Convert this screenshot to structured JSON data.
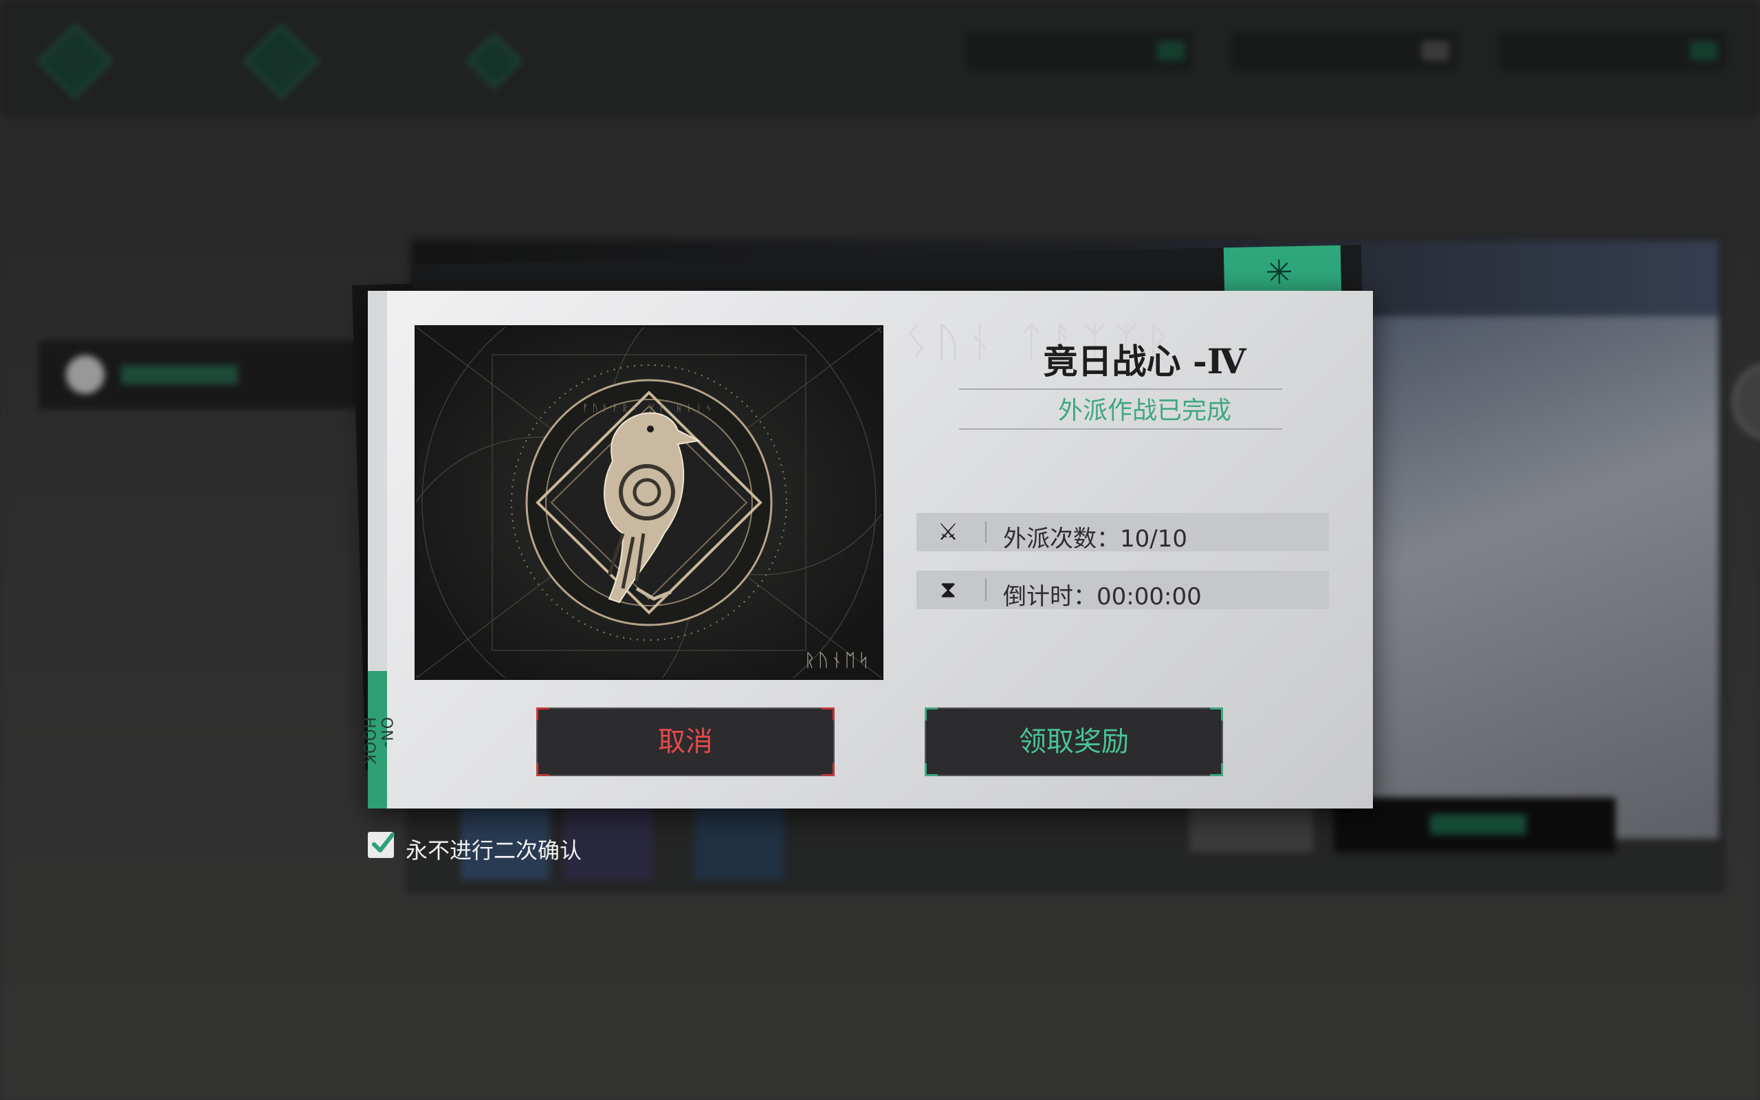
{
  "dialog": {
    "title": "竟日战心 -Ⅳ",
    "subtitle": "外派作战已完成",
    "side_tag": "ON-HOOK",
    "dispatch": {
      "label": "外派次数：",
      "value": "10/10"
    },
    "countdown": {
      "label": "倒计时：",
      "value": "00:00:00"
    },
    "cancel_label": "取消",
    "claim_label": "领取奖励",
    "image_runes": "ᚱᚢᚾᛖᛋ",
    "header_runes": "ᛊᚢᚾ ᛏᚨᛉᛉᚱ"
  },
  "confirm": {
    "label": "永不进行二次确认",
    "checked": true
  },
  "icons": {
    "dispatch": "crossed-swords-icon",
    "countdown": "hourglass-icon",
    "check": "checkmark-icon"
  },
  "colors": {
    "accent_green": "#3fa87f",
    "cancel_red": "#e34a4a",
    "claim_green": "#49c494"
  }
}
